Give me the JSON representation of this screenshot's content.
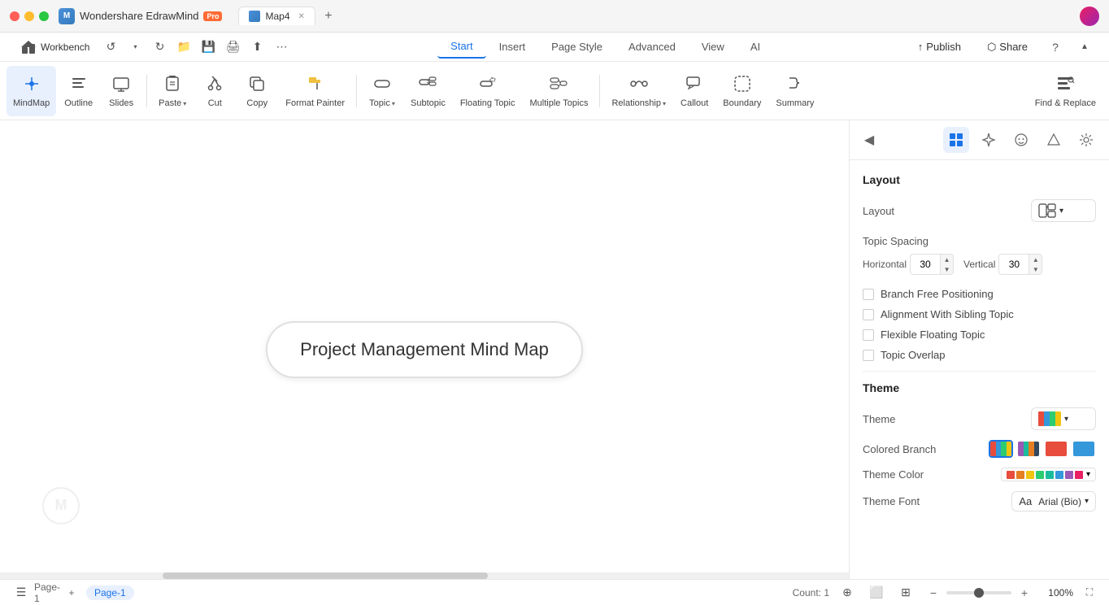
{
  "app": {
    "name": "Wondershare EdrawMind",
    "badge": "Pro",
    "tab_name": "Map4"
  },
  "title_bar": {
    "buttons": [
      "close",
      "minimize",
      "maximize"
    ]
  },
  "menu": {
    "workbench": "Workbench",
    "tabs": [
      "Start",
      "Insert",
      "Page Style",
      "Advanced",
      "View",
      "AI"
    ],
    "active_tab": "Start",
    "publish": "Publish",
    "share": "Share"
  },
  "toolbar": {
    "mindmap_label": "MindMap",
    "outline_label": "Outline",
    "slides_label": "Slides",
    "paste_label": "Paste",
    "cut_label": "Cut",
    "copy_label": "Copy",
    "format_painter_label": "Format Painter",
    "topic_label": "Topic",
    "subtopic_label": "Subtopic",
    "floating_topic_label": "Floating Topic",
    "multiple_topics_label": "Multiple Topics",
    "relationship_label": "Relationship",
    "callout_label": "Callout",
    "boundary_label": "Boundary",
    "summary_label": "Summary",
    "find_replace_label": "Find & Replace"
  },
  "canvas": {
    "main_node_text": "Project Management Mind Map"
  },
  "right_panel": {
    "collapse_icon": "◀",
    "tab_icons": [
      "layout",
      "sparkle",
      "emoji",
      "shape",
      "settings"
    ],
    "layout_section_title": "Layout",
    "layout_label": "Layout",
    "layout_value": "balanced",
    "topic_spacing_label": "Topic Spacing",
    "horizontal_label": "Horizontal",
    "horizontal_value": "30",
    "vertical_label": "Vertical",
    "vertical_value": "30",
    "checkboxes": [
      {
        "id": "branch_free",
        "label": "Branch Free Positioning",
        "checked": false
      },
      {
        "id": "alignment",
        "label": "Alignment With Sibling Topic",
        "checked": false
      },
      {
        "id": "flexible_floating",
        "label": "Flexible Floating Topic",
        "checked": false
      },
      {
        "id": "topic_overlap",
        "label": "Topic Overlap",
        "checked": false
      }
    ],
    "theme_section_title": "Theme",
    "theme_label": "Theme",
    "colored_branch_label": "Colored Branch",
    "theme_color_label": "Theme Color",
    "theme_font_label": "Theme Font",
    "font_value": "Arial (Bio)",
    "font_prefix": "Aa",
    "theme_colors": [
      "#e74c3c",
      "#e67e22",
      "#f1c40f",
      "#2ecc71",
      "#1abc9c",
      "#3498db",
      "#9b59b6",
      "#e91e63"
    ]
  },
  "status_bar": {
    "page_label": "Page-1",
    "page_tab": "Page-1",
    "count_label": "Count: 1",
    "zoom_value": "100%",
    "add_page_icon": "+"
  }
}
